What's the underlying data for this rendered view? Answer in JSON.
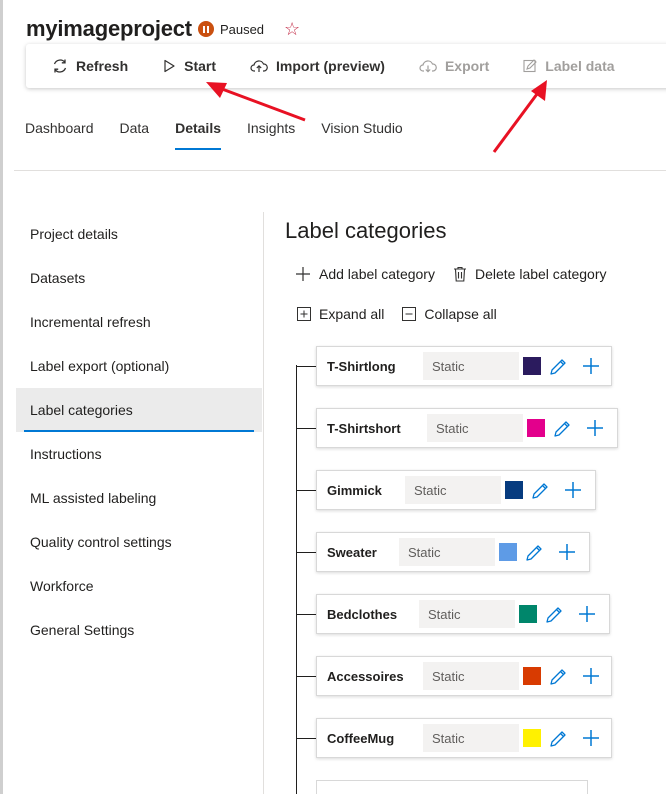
{
  "project": {
    "title": "myimageproject",
    "status": "Paused"
  },
  "toolbar": {
    "refresh": "Refresh",
    "start": "Start",
    "import": "Import (preview)",
    "export": "Export",
    "label_data": "Label data"
  },
  "tabs": [
    "Dashboard",
    "Data",
    "Details",
    "Insights",
    "Vision Studio"
  ],
  "sidenav": [
    "Project details",
    "Datasets",
    "Incremental refresh",
    "Label export (optional)",
    "Label categories",
    "Instructions",
    "ML assisted labeling",
    "Quality control settings",
    "Workforce",
    "General Settings"
  ],
  "section": {
    "title": "Label categories",
    "add_category": "Add label category",
    "delete_category": "Delete label category",
    "expand_all": "Expand all",
    "collapse_all": "Collapse all"
  },
  "categories": [
    {
      "name": "T-Shirtlong",
      "type": "Static",
      "color": "#2b1b5e"
    },
    {
      "name": "T-Shirtshort",
      "type": "Static",
      "color": "#e3008c"
    },
    {
      "name": "Gimmick",
      "type": "Static",
      "color": "#063b7f"
    },
    {
      "name": "Sweater",
      "type": "Static",
      "color": "#5e9be6"
    },
    {
      "name": "Bedclothes",
      "type": "Static",
      "color": "#00866b"
    },
    {
      "name": "Accessoires",
      "type": "Static",
      "color": "#d83b01"
    },
    {
      "name": "CoffeeMug",
      "type": "Static",
      "color": "#fff100"
    }
  ],
  "colors": {
    "accent": "#0078d4",
    "paused": "#ca5010",
    "annotation_arrow": "#e81123"
  }
}
